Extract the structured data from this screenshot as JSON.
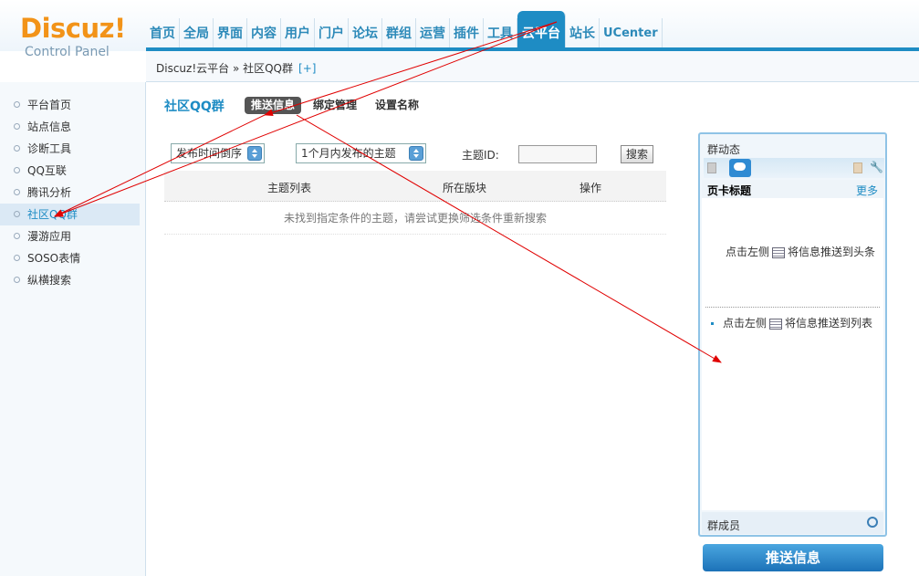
{
  "logo": {
    "title": "Discuz!",
    "subtitle": "Control Panel"
  },
  "nav": [
    {
      "label": "首页",
      "active": false
    },
    {
      "label": "全局",
      "active": false
    },
    {
      "label": "界面",
      "active": false
    },
    {
      "label": "内容",
      "active": false
    },
    {
      "label": "用户",
      "active": false
    },
    {
      "label": "门户",
      "active": false
    },
    {
      "label": "论坛",
      "active": false
    },
    {
      "label": "群组",
      "active": false
    },
    {
      "label": "运营",
      "active": false
    },
    {
      "label": "插件",
      "active": false
    },
    {
      "label": "工具",
      "active": false
    },
    {
      "label": "云平台",
      "active": true
    },
    {
      "label": "站长",
      "active": false
    },
    {
      "label": "UCenter",
      "active": false
    }
  ],
  "breadcrumb": {
    "text": "Discuz!云平台 » 社区QQ群",
    "add": "[+]"
  },
  "sidebar": {
    "items": [
      {
        "label": "平台首页"
      },
      {
        "label": "站点信息"
      },
      {
        "label": "诊断工具"
      },
      {
        "label": "QQ互联"
      },
      {
        "label": "腾讯分析"
      },
      {
        "label": "社区QQ群",
        "active": true
      },
      {
        "label": "漫游应用"
      },
      {
        "label": "SOSO表情"
      },
      {
        "label": "纵横搜索"
      }
    ]
  },
  "main": {
    "title": "社区QQ群",
    "tabs": [
      {
        "label": "推送信息",
        "active": true
      },
      {
        "label": "绑定管理",
        "active": false
      },
      {
        "label": "设置名称",
        "active": false
      }
    ],
    "filters": {
      "order_select": "发布时间倒序",
      "time_select": "1个月内发布的主题",
      "tid_label": "主题ID:",
      "tid_value": "",
      "search_label": "搜索"
    },
    "table": {
      "headers": [
        "主题列表",
        "所在版块",
        "操作"
      ],
      "empty_text": "未找到指定条件的主题，请尝试更换筛选条件重新搜索"
    }
  },
  "panel": {
    "title": "群动态",
    "card_title": "页卡标题",
    "more": "更多",
    "hint_top_prefix": "点击左侧",
    "hint_top_suffix": "将信息推送到头条",
    "hint_list_prefix": "点击左侧",
    "hint_list_suffix": "将信息推送到列表",
    "footer_label": "群成员",
    "push_button": "推送信息"
  },
  "colors": {
    "accent": "#1e8cc4",
    "logo": "#f29318",
    "annotation": "#e00000"
  }
}
